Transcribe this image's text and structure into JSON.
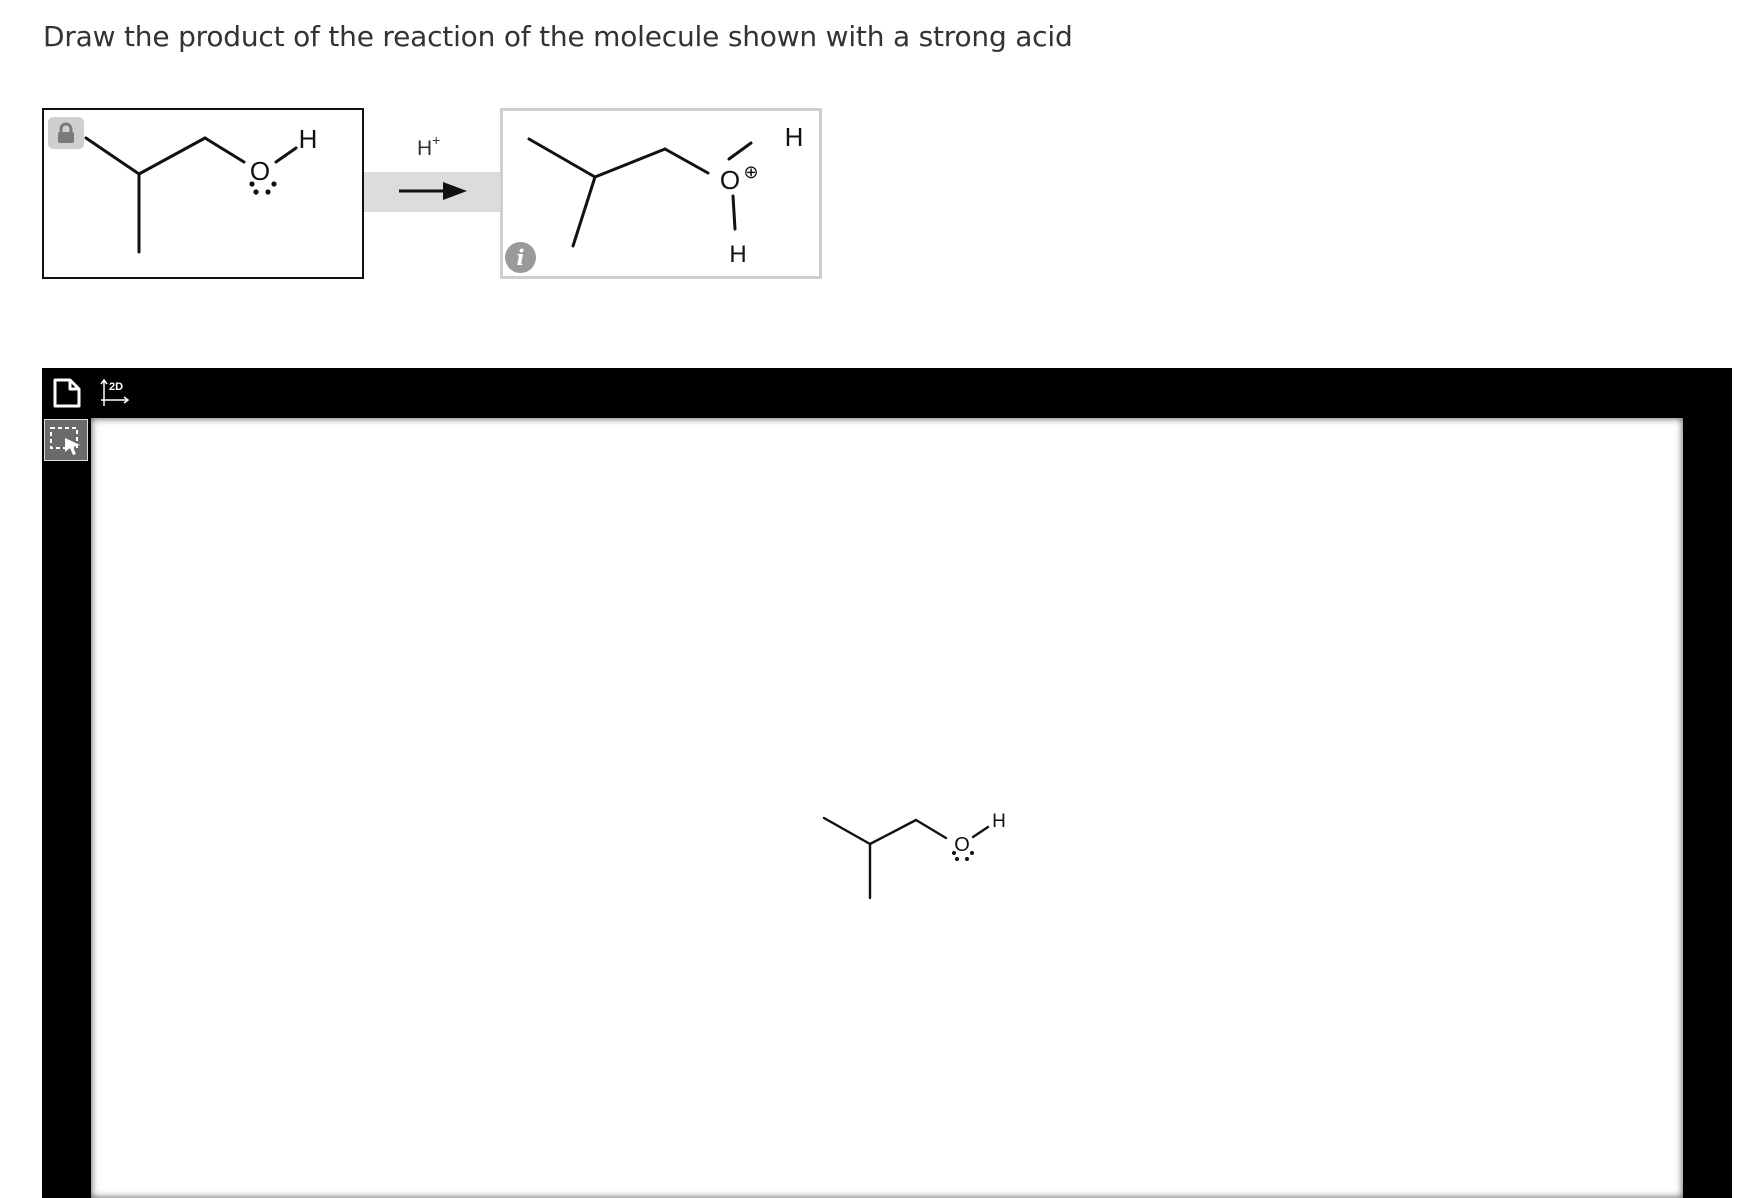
{
  "question": {
    "prompt": "Draw the product of the reaction of the molecule shown with a strong acid"
  },
  "reaction": {
    "reactant": {
      "locked": true,
      "atoms": {
        "oxygen": "O",
        "hydrogen": "H"
      },
      "lone_pairs": 2
    },
    "reagent": {
      "base": "H",
      "charge": "+"
    },
    "product": {
      "atoms": {
        "oxygen": "O",
        "hydrogen_top": "H",
        "hydrogen_bottom": "H"
      },
      "charge_symbol": "⊕"
    },
    "info_icon": "i"
  },
  "editor": {
    "toolbar": {
      "new_document_icon": "document-icon",
      "clean_2d_label": "2D",
      "select_tool_icon": "marquee-select-icon"
    },
    "canvas_molecule": {
      "atoms": {
        "oxygen": "O",
        "hydrogen": "H"
      },
      "lone_pairs": 2
    }
  },
  "colors": {
    "editor_frame": "#000000",
    "box_border_reactant": "#111111",
    "box_border_product": "#cfcfcf",
    "arrow_band": "#dcdcdc"
  }
}
